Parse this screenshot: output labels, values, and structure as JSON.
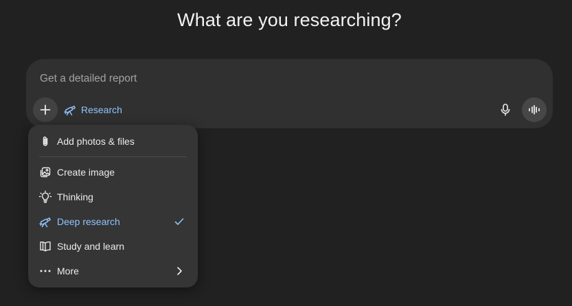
{
  "heading": "What are you researching?",
  "composer": {
    "placeholder": "Get a detailed report",
    "value": "",
    "active_tool_label": "Research",
    "active_tool_icon": "telescope-icon",
    "plus_icon": "plus-icon",
    "mic_icon": "microphone-icon",
    "voice_icon": "voice-waveform-icon"
  },
  "menu": {
    "items": [
      {
        "label": "Add photos & files",
        "icon": "paperclip-icon"
      },
      {
        "label": "Create image",
        "icon": "image-icon"
      },
      {
        "label": "Thinking",
        "icon": "lightbulb-icon"
      },
      {
        "label": "Deep research",
        "icon": "telescope-icon",
        "selected": true,
        "trailing_icon": "checkmark-icon"
      },
      {
        "label": "Study and learn",
        "icon": "book-icon"
      },
      {
        "label": "More",
        "icon": "more-dots-icon",
        "trailing_icon": "chevron-right-icon"
      }
    ]
  },
  "colors": {
    "background": "#212121",
    "composer": "#303030",
    "menu": "#353535",
    "accent": "#8ec5ff"
  }
}
